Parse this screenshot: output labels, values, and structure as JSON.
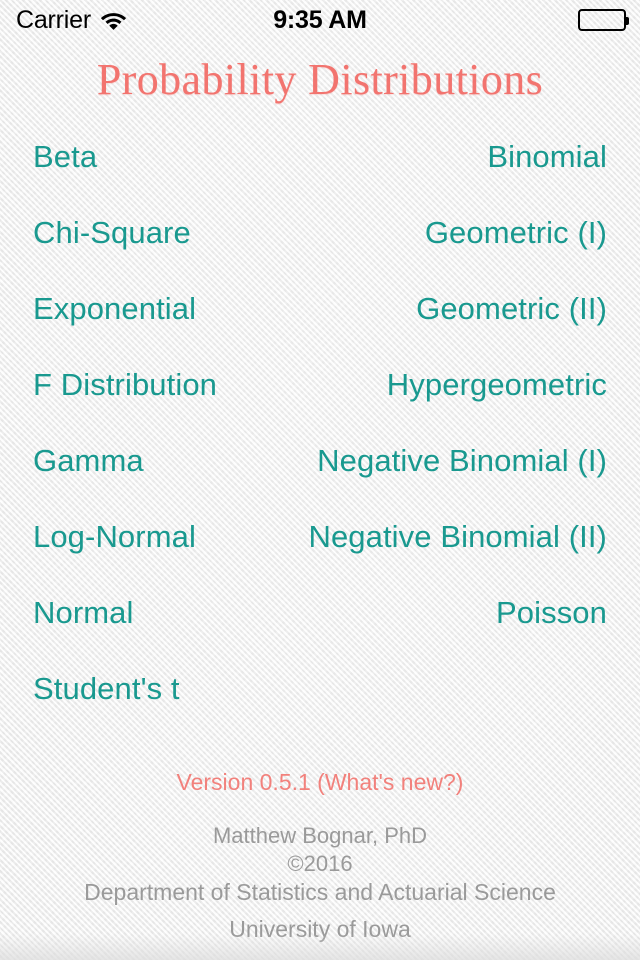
{
  "status_bar": {
    "carrier": "Carrier",
    "wifi_icon": "wifi-icon",
    "time": "9:35 AM",
    "battery_icon": "battery-full-icon"
  },
  "header": {
    "title": "Probability Distributions"
  },
  "distributions": {
    "rows": [
      {
        "left": "Beta",
        "right": "Binomial"
      },
      {
        "left": "Chi-Square",
        "right": "Geometric (I)"
      },
      {
        "left": "Exponential",
        "right": "Geometric (II)"
      },
      {
        "left": "F Distribution",
        "right": "Hypergeometric"
      },
      {
        "left": "Gamma",
        "right": "Negative Binomial (I)"
      },
      {
        "left": "Log-Normal",
        "right": "Negative Binomial (II)"
      },
      {
        "left": "Normal",
        "right": "Poisson"
      },
      {
        "left": "Student's t",
        "right": ""
      }
    ]
  },
  "footer": {
    "version": "Version 0.5.1 (What's new?)",
    "author": "Matthew Bognar, PhD",
    "copyright": "©2016",
    "department": "Department of Statistics and Actuarial Science",
    "university": "University of Iowa"
  },
  "colors": {
    "accent_teal": "#19998f",
    "accent_coral": "#f2746f",
    "background": "#f1f1f1",
    "credits_gray": "#9a9a9a"
  }
}
